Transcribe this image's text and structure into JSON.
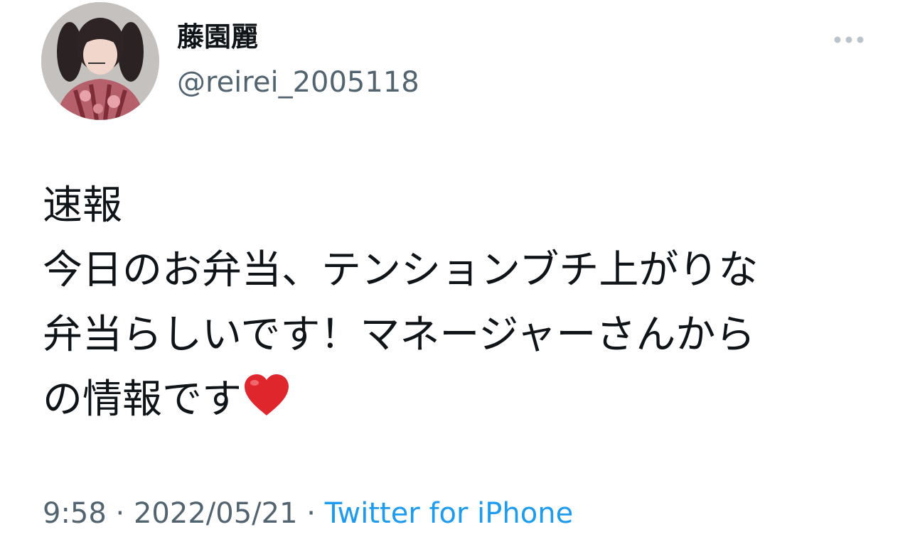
{
  "author": {
    "display_name": "藤園麗",
    "handle": "@reirei_2005118"
  },
  "tweet": {
    "lines": [
      "速報",
      "今日のお弁当、テンションブチ上がりな",
      "弁当らしいです！マネージャーさんから",
      "の情報です"
    ],
    "emoji": "red-heart"
  },
  "meta": {
    "time": "9:58",
    "separator": "·",
    "date": "2022/05/21",
    "source": "Twitter for iPhone"
  },
  "icons": {
    "more": "more-horizontal-icon",
    "heart": "red-heart-icon"
  },
  "colors": {
    "text": "#0f1419",
    "secondary": "#536471",
    "link": "#1d9bf0",
    "heart": "#e0262d"
  }
}
